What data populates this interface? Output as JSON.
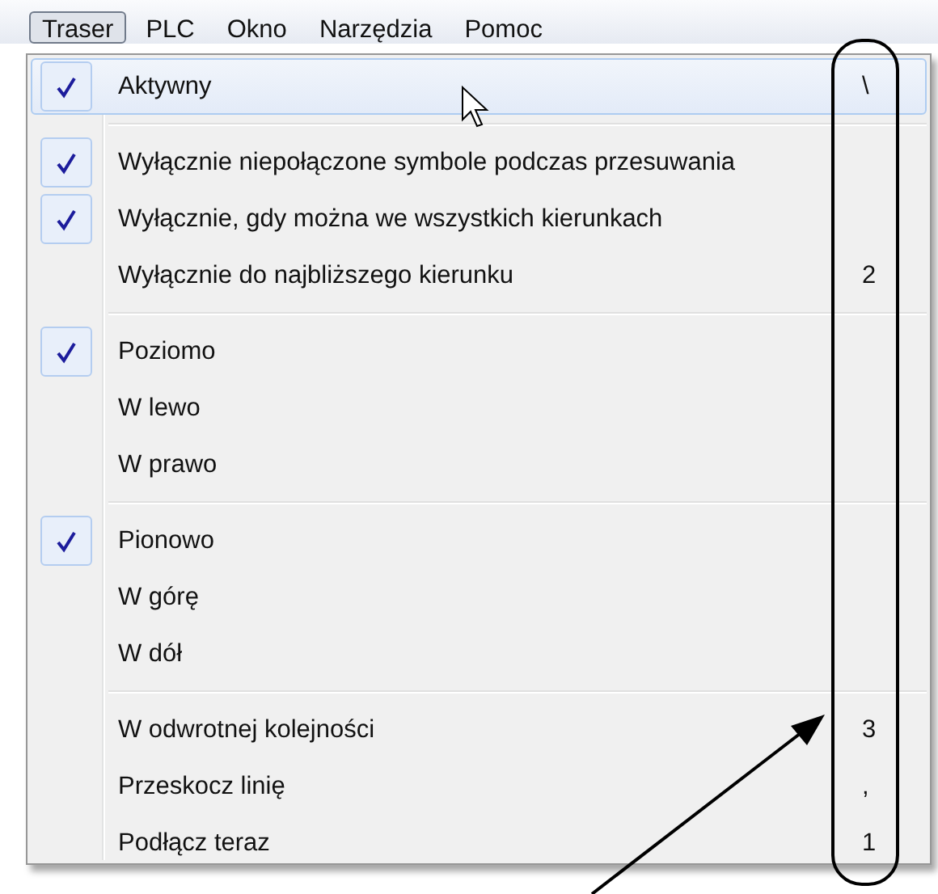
{
  "menu_bar": [
    {
      "label": "Traser",
      "selected": true
    },
    {
      "label": "PLC",
      "selected": false
    },
    {
      "label": "Okno",
      "selected": false
    },
    {
      "label": "Narzędzia",
      "selected": false
    },
    {
      "label": "Pomoc",
      "selected": false
    }
  ],
  "menu": {
    "sections": [
      {
        "items": [
          {
            "label": "Aktywny",
            "checked": true,
            "highlighted": true,
            "shortcut": "\\"
          }
        ]
      },
      {
        "items": [
          {
            "label": "Wyłącznie niepołączone symbole podczas przesuwania",
            "checked": true,
            "highlighted": false
          },
          {
            "label": "Wyłącznie, gdy można we wszystkich kierunkach",
            "checked": true,
            "highlighted": false
          },
          {
            "label": "Wyłącznie do najbliższego kierunku",
            "checked": false,
            "highlighted": false,
            "shortcut": "2"
          }
        ]
      },
      {
        "items": [
          {
            "label": "Poziomo",
            "checked": true,
            "highlighted": false
          },
          {
            "label": "W lewo",
            "checked": false,
            "highlighted": false
          },
          {
            "label": "W prawo",
            "checked": false,
            "highlighted": false
          }
        ]
      },
      {
        "items": [
          {
            "label": "Pionowo",
            "checked": true,
            "highlighted": false
          },
          {
            "label": "W górę",
            "checked": false,
            "highlighted": false
          },
          {
            "label": "W dół",
            "checked": false,
            "highlighted": false
          }
        ]
      },
      {
        "items": [
          {
            "label": "W odwrotnej kolejności",
            "checked": false,
            "highlighted": false,
            "shortcut": "3"
          },
          {
            "label": "Przeskocz linię",
            "checked": false,
            "highlighted": false,
            "shortcut": ","
          },
          {
            "label": "Podłącz teraz",
            "checked": false,
            "highlighted": false,
            "shortcut": "1"
          }
        ]
      }
    ]
  }
}
